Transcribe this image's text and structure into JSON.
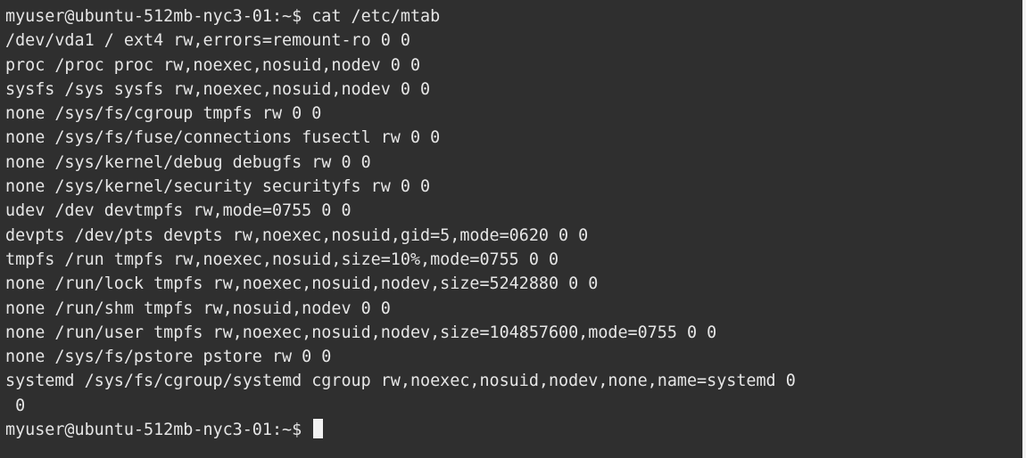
{
  "terminal": {
    "prompt": "myuser@ubuntu-512mb-nyc3-01:~$ cat /etc/mtab",
    "lines": [
      "/dev/vda1 / ext4 rw,errors=remount-ro 0 0",
      "proc /proc proc rw,noexec,nosuid,nodev 0 0",
      "sysfs /sys sysfs rw,noexec,nosuid,nodev 0 0",
      "none /sys/fs/cgroup tmpfs rw 0 0",
      "none /sys/fs/fuse/connections fusectl rw 0 0",
      "none /sys/kernel/debug debugfs rw 0 0",
      "none /sys/kernel/security securityfs rw 0 0",
      "udev /dev devtmpfs rw,mode=0755 0 0",
      "devpts /dev/pts devpts rw,noexec,nosuid,gid=5,mode=0620 0 0",
      "tmpfs /run tmpfs rw,noexec,nosuid,size=10%,mode=0755 0 0",
      "none /run/lock tmpfs rw,noexec,nosuid,nodev,size=5242880 0 0",
      "none /run/shm tmpfs rw,nosuid,nodev 0 0",
      "none /run/user tmpfs rw,noexec,nosuid,nodev,size=104857600,mode=0755 0 0",
      "none /sys/fs/pstore pstore rw 0 0",
      "systemd /sys/fs/cgroup/systemd cgroup rw,noexec,nosuid,nodev,none,name=systemd 0",
      " 0"
    ],
    "final_prompt": "myuser@ubuntu-512mb-nyc3-01:~$ ",
    "background_color": "#2f2f2f",
    "text_color": "#e6e6e6"
  }
}
